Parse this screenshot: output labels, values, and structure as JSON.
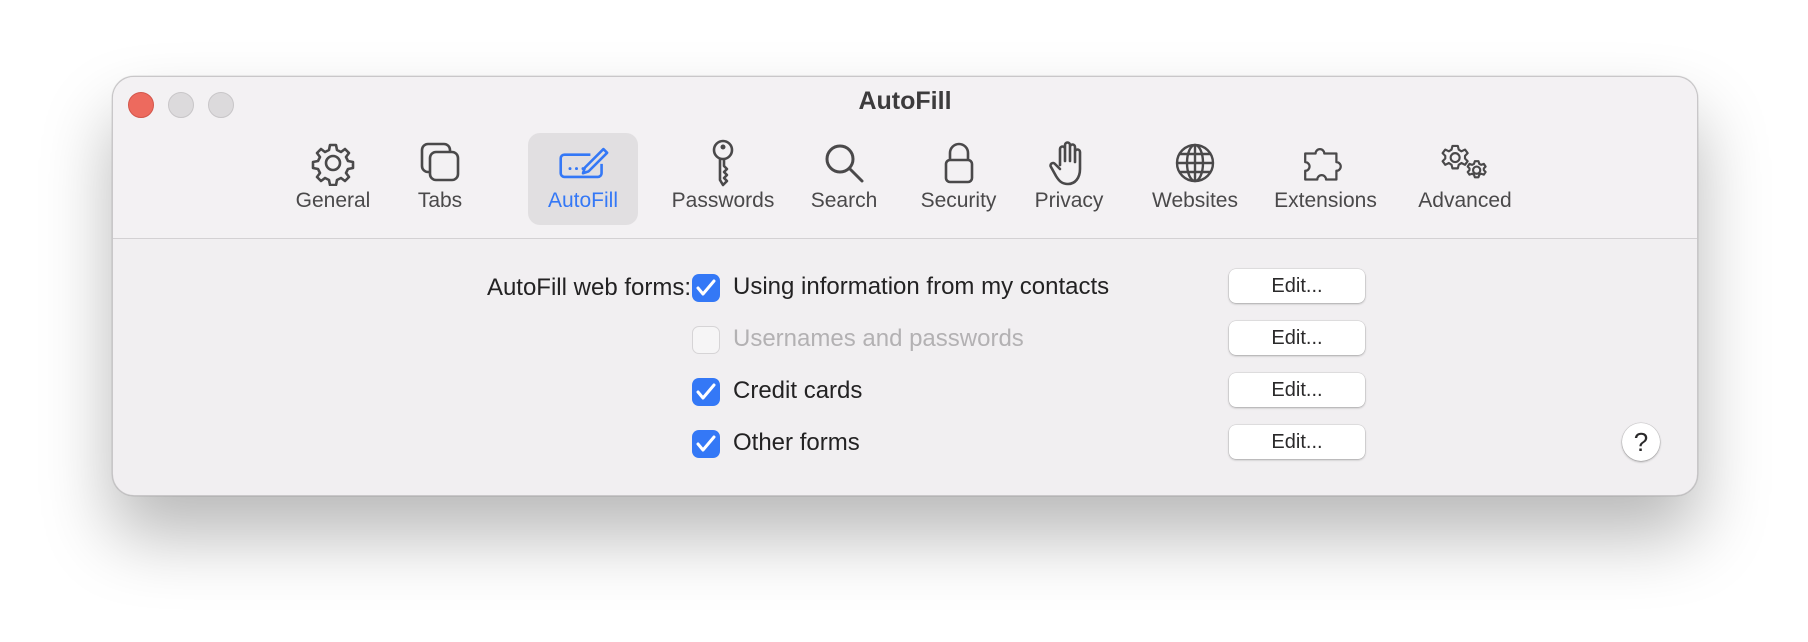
{
  "window": {
    "title": "AutoFill"
  },
  "toolbar": {
    "active": "AutoFill",
    "accent_color": "#3478f6",
    "items": [
      {
        "label": "General",
        "icon": "gear-icon"
      },
      {
        "label": "Tabs",
        "icon": "tabs-icon"
      },
      {
        "label": "AutoFill",
        "icon": "autofill-icon"
      },
      {
        "label": "Passwords",
        "icon": "key-icon"
      },
      {
        "label": "Search",
        "icon": "magnifier-icon"
      },
      {
        "label": "Security",
        "icon": "lock-icon"
      },
      {
        "label": "Privacy",
        "icon": "hand-icon"
      },
      {
        "label": "Websites",
        "icon": "globe-icon"
      },
      {
        "label": "Extensions",
        "icon": "puzzle-icon"
      },
      {
        "label": "Advanced",
        "icon": "gears-icon"
      }
    ]
  },
  "autofill": {
    "section_label": "AutoFill web forms:",
    "options": [
      {
        "label": "Using information from my contacts",
        "checked": true,
        "enabled": true,
        "button": "Edit..."
      },
      {
        "label": "Usernames and passwords",
        "checked": false,
        "enabled": false,
        "button": "Edit..."
      },
      {
        "label": "Credit cards",
        "checked": true,
        "enabled": true,
        "button": "Edit..."
      },
      {
        "label": "Other forms",
        "checked": true,
        "enabled": true,
        "button": "Edit..."
      }
    ]
  },
  "help": {
    "label": "?"
  }
}
